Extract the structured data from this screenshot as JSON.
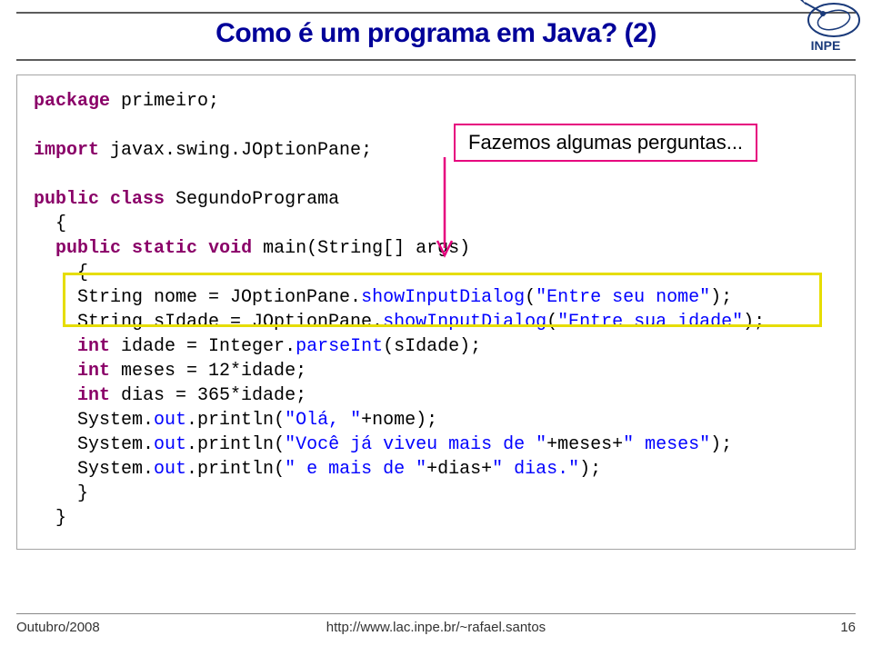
{
  "title": "Como é um programa em Java? (2)",
  "annotation": "Fazemos algumas perguntas...",
  "code": {
    "l1_kw": "package",
    "l1_rest": " primeiro;",
    "l3_kw": "import",
    "l3_rest": " javax.swing.JOptionPane;",
    "l5_kw1": "public",
    "l5_kw2": "class",
    "l5_rest": " SegundoPrograma",
    "l6": "  {",
    "l7_kw1": "public",
    "l7_kw2": "static",
    "l7_kw3": "void",
    "l7_rest": " main(String[] args)",
    "l8": "    {",
    "l9a": "    String nome = JOptionPane.",
    "l9b": "showInputDialog",
    "l9c": "(",
    "l9d": "\"Entre seu nome\"",
    "l9e": ");",
    "l10a": "    String sIdade = JOptionPane.",
    "l10b": "showInputDialog",
    "l10c": "(",
    "l10d": "\"Entre sua idade\"",
    "l10e": ");",
    "l11_kw": "int",
    "l11a": " idade = Integer.",
    "l11b": "parseInt",
    "l11c": "(sIdade);",
    "l12_kw": "int",
    "l12a": " meses = 12*idade;",
    "l13_kw": "int",
    "l13a": " dias = 365*idade;",
    "l14a": "    System.",
    "l14b": "out",
    "l14c": ".println(",
    "l14d": "\"Olá, \"",
    "l14e": "+nome);",
    "l15a": "    System.",
    "l15b": "out",
    "l15c": ".println(",
    "l15d": "\"Você já viveu mais de \"",
    "l15e": "+meses+",
    "l15f": "\" meses\"",
    "l15g": ");",
    "l16a": "    System.",
    "l16b": "out",
    "l16c": ".println(",
    "l16d": "\" e mais de \"",
    "l16e": "+dias+",
    "l16f": "\" dias.\"",
    "l16g": ");",
    "l17": "    }",
    "l18": "  }"
  },
  "footer": {
    "left": "Outubro/2008",
    "center": "http://www.lac.inpe.br/~rafael.santos",
    "right": "16"
  }
}
